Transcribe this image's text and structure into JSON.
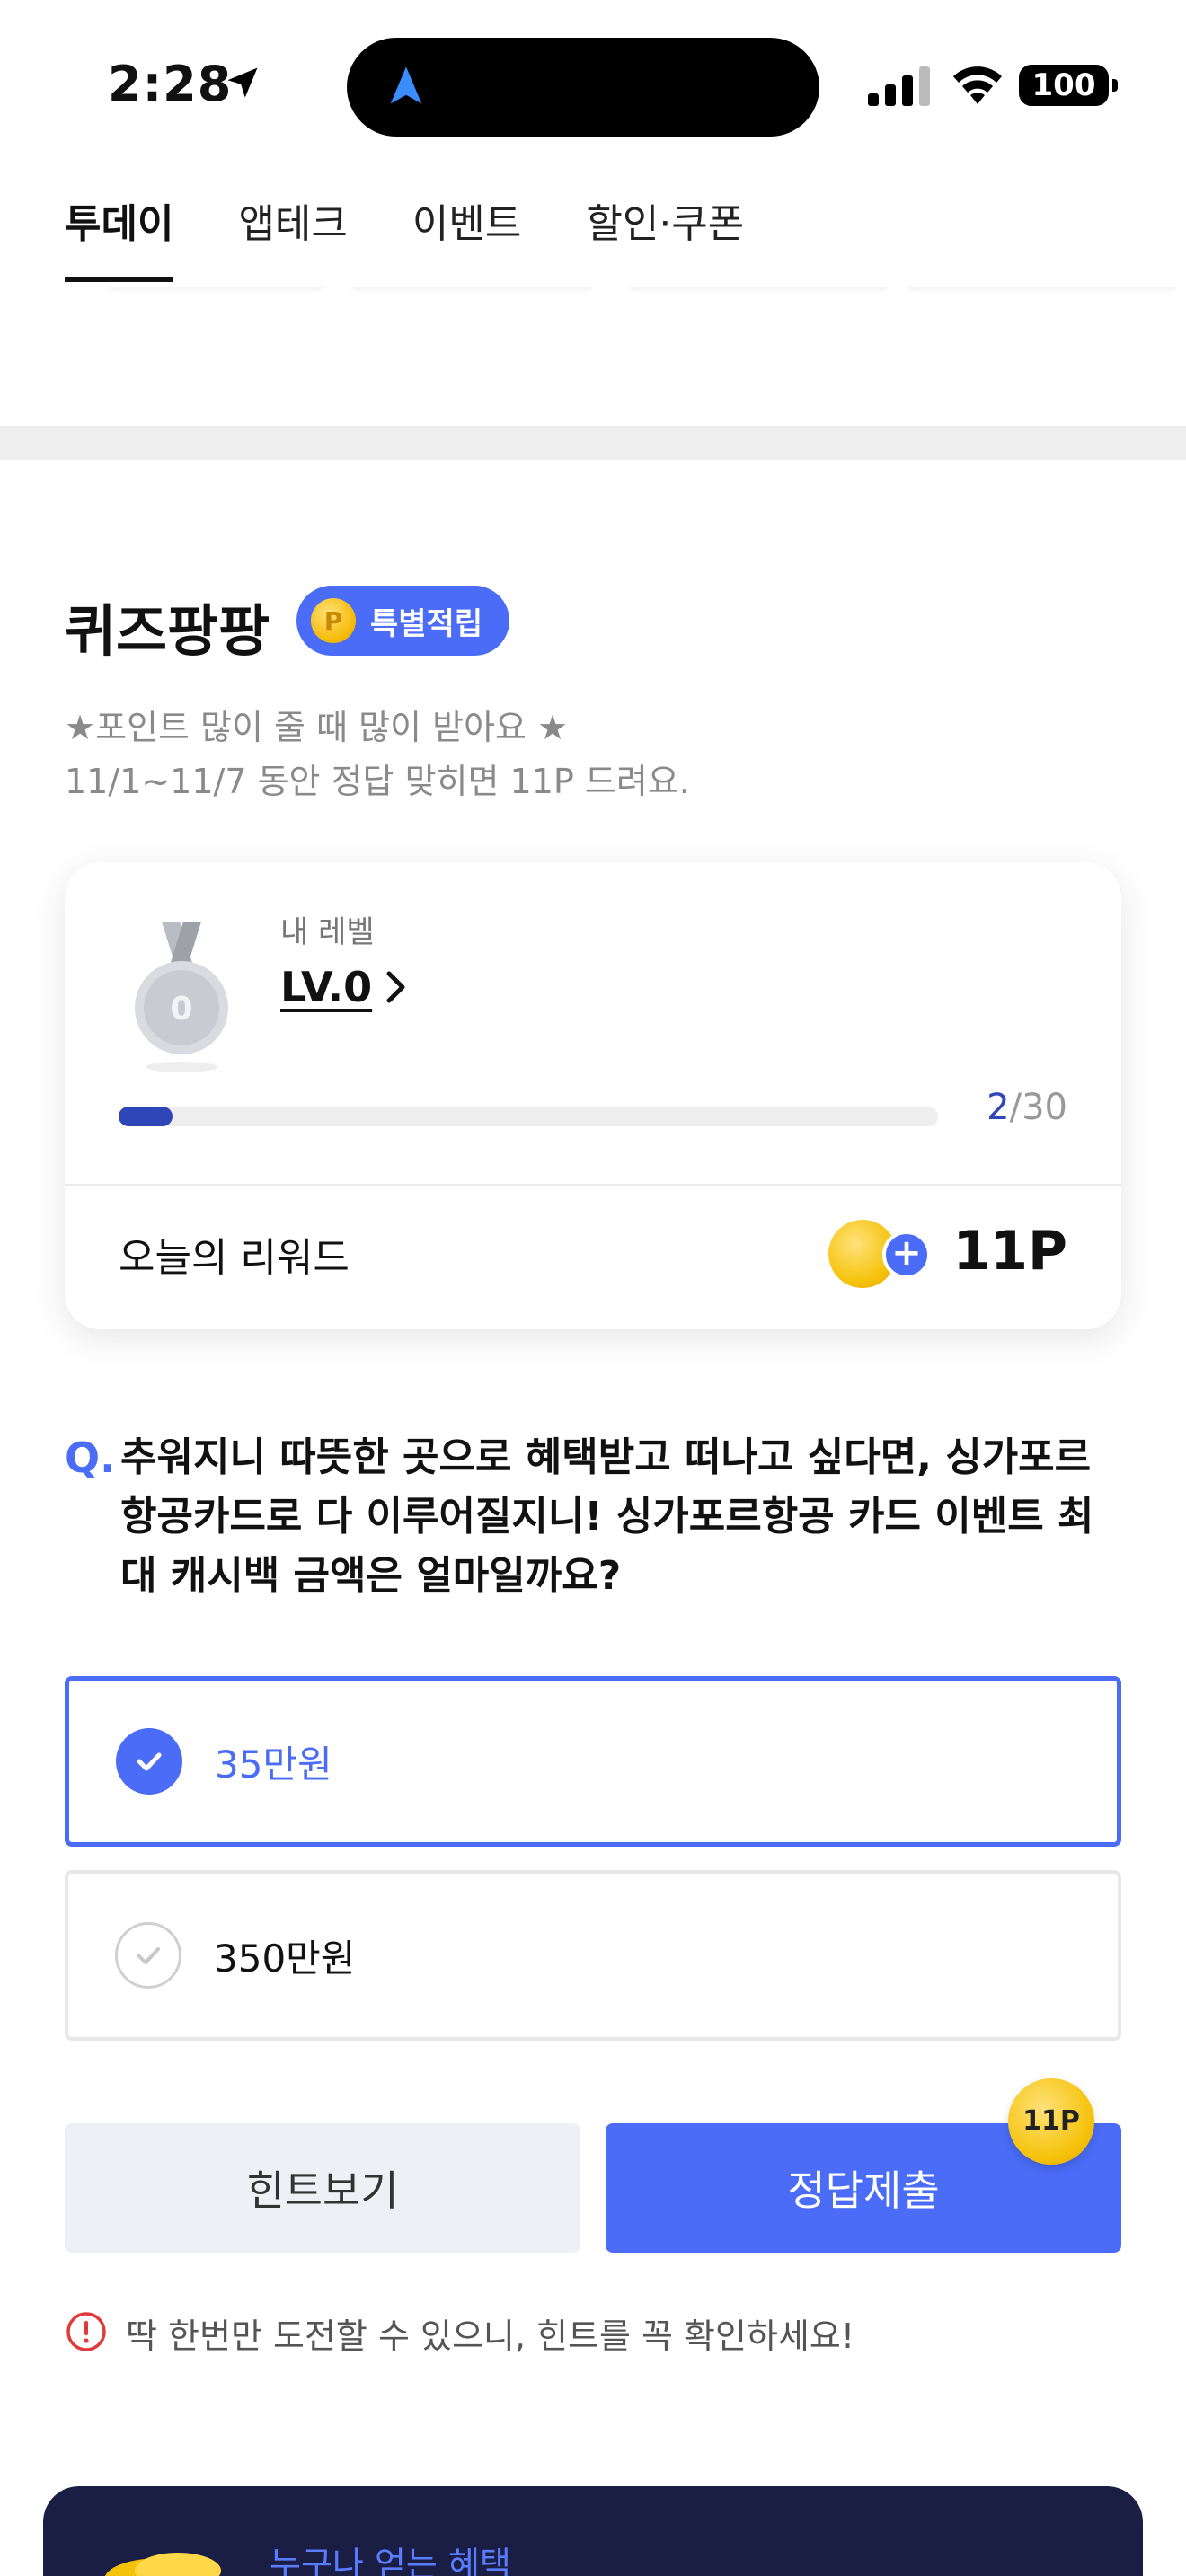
{
  "status_bar": {
    "time": "2:28",
    "battery": "100"
  },
  "tabs": [
    {
      "label": "투데이",
      "active": true
    },
    {
      "label": "앱테크",
      "active": false
    },
    {
      "label": "이벤트",
      "active": false
    },
    {
      "label": "할인·쿠폰",
      "active": false
    }
  ],
  "quiz": {
    "title": "퀴즈팡팡",
    "badge_label": "특별적립",
    "badge_coin_letter": "P",
    "desc_line1": "★포인트 많이 줄 때 많이 받아요 ★",
    "desc_line2": "11/1~11/7 동안 정답 맞히면 11P 드려요."
  },
  "level_card": {
    "label": "내 레벨",
    "value": "LV.0",
    "medal_number": "0",
    "progress_current": "2",
    "progress_total": "/30",
    "progress_fraction": 0.066,
    "reward_label": "오늘의 리워드",
    "reward_plus": "+",
    "reward_points": "11P"
  },
  "question": {
    "prefix": "Q.",
    "text": "추워지니 따뜻한 곳으로 혜택받고 떠나고 싶다면, 싱가포르 항공카드로 다 이루어질지니! 싱가포르항공 카드 이벤트 최대 캐시백 금액은 얼마일까요?"
  },
  "options": [
    {
      "label": "35만원",
      "selected": true
    },
    {
      "label": "350만원",
      "selected": false
    }
  ],
  "buttons": {
    "hint": "힌트보기",
    "submit": "정답제출",
    "submit_badge": "11P"
  },
  "warning": "딱 한번만 도전할 수 있으니, 힌트를 꼭 확인하세요!",
  "banner": {
    "text": "누구나 얻는 혜택"
  },
  "colors": {
    "accent": "#4a6cf7",
    "progress": "#2f46b8",
    "banner_bg": "#1a1e45",
    "warning": "#e03a3a"
  }
}
